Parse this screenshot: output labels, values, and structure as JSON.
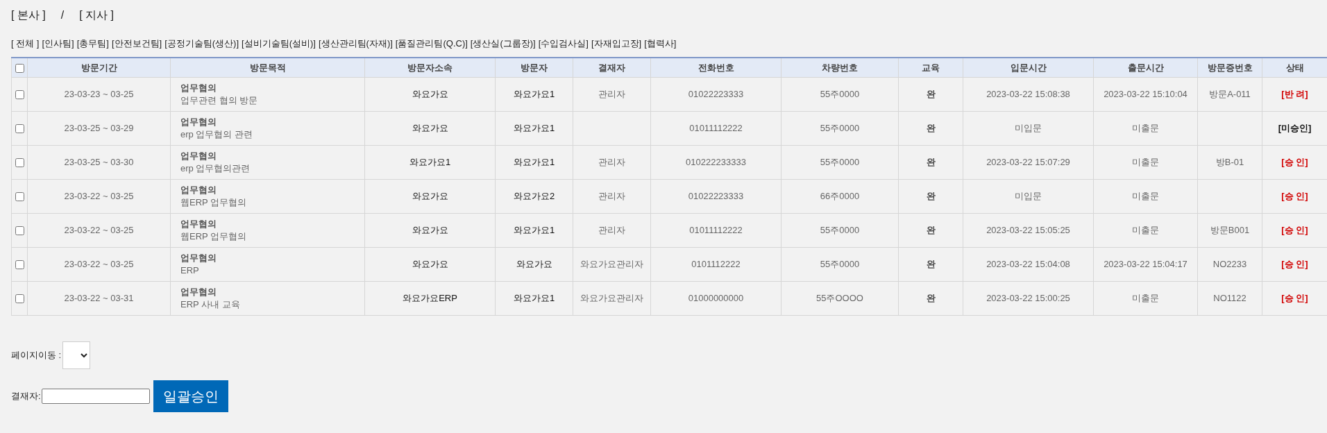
{
  "branch_links": [
    "[ 본사 ]",
    "[ 지사 ]"
  ],
  "branch_separator": "/",
  "department_links": [
    "[ 전체 ]",
    "[인사팀]",
    "[총무팀]",
    "[안전보건팀]",
    "[공정기술팀(생산)]",
    "[설비기술팀(설비)]",
    "[생산관리팀(자재)]",
    "[품질관리팀(Q.C)]",
    "[생산실(그룹장)]",
    "[수입검사실]",
    "[자재입고장]",
    "[협력사]"
  ],
  "table": {
    "select_all_checked": false,
    "columns": [
      "방문기간",
      "방문목적",
      "방문자소속",
      "방문자",
      "결재자",
      "전화번호",
      "차량번호",
      "교육",
      "입문시간",
      "출문시간",
      "방문증번호",
      "상태"
    ],
    "rows": [
      {
        "checked": false,
        "period": "23-03-23 ~ 03-25",
        "purpose_title": "업무협의",
        "purpose_detail": "업무관련 협의 방문",
        "company": "와요가요",
        "visitor": "와요가요1",
        "approver": "관리자",
        "phone": "01022223333",
        "vehicle": "55주0000",
        "education": "완",
        "entry_time": "2023-03-22 15:08:38",
        "exit_time": "2023-03-22 15:10:04",
        "pass_number": "방문A-011",
        "status": {
          "text": "[반 려]",
          "color": "#d10000"
        }
      },
      {
        "checked": false,
        "period": "23-03-25 ~ 03-29",
        "purpose_title": "업무협의",
        "purpose_detail": "erp 업무협의 관련",
        "company": "와요가요",
        "visitor": "와요가요1",
        "approver": "",
        "phone": "01011112222",
        "vehicle": "55주0000",
        "education": "완",
        "entry_time": "미입문",
        "exit_time": "미출문",
        "pass_number": "",
        "status": {
          "text": "[미승인]",
          "color": "#111111"
        }
      },
      {
        "checked": false,
        "period": "23-03-25 ~ 03-30",
        "purpose_title": "업무협의",
        "purpose_detail": "erp 업무협의관련",
        "company": "와요가요1",
        "visitor": "와요가요1",
        "approver": "관리자",
        "phone": "010222233333",
        "vehicle": "55주0000",
        "education": "완",
        "entry_time": "2023-03-22 15:07:29",
        "exit_time": "미출문",
        "pass_number": "방B-01",
        "status": {
          "text": "[승 인]",
          "color": "#d10000"
        }
      },
      {
        "checked": false,
        "period": "23-03-22 ~ 03-25",
        "purpose_title": "업무협의",
        "purpose_detail": "웹ERP 업무협의",
        "company": "와요가요",
        "visitor": "와요가요2",
        "approver": "관리자",
        "phone": "01022223333",
        "vehicle": "66주0000",
        "education": "완",
        "entry_time": "미입문",
        "exit_time": "미출문",
        "pass_number": "",
        "status": {
          "text": "[승 인]",
          "color": "#d10000"
        }
      },
      {
        "checked": false,
        "period": "23-03-22 ~ 03-25",
        "purpose_title": "업무협의",
        "purpose_detail": "웹ERP 업무협의",
        "company": "와요가요",
        "visitor": "와요가요1",
        "approver": "관리자",
        "phone": "01011112222",
        "vehicle": "55주0000",
        "education": "완",
        "entry_time": "2023-03-22 15:05:25",
        "exit_time": "미출문",
        "pass_number": "방문B001",
        "status": {
          "text": "[승 인]",
          "color": "#d10000"
        }
      },
      {
        "checked": false,
        "period": "23-03-22 ~ 03-25",
        "purpose_title": "업무협의",
        "purpose_detail": "ERP",
        "company": "와요가요",
        "visitor": "와요가요",
        "approver": "와요가요관리자",
        "phone": "0101112222",
        "vehicle": "55주0000",
        "education": "완",
        "entry_time": "2023-03-22 15:04:08",
        "exit_time": "2023-03-22 15:04:17",
        "pass_number": "NO2233",
        "status": {
          "text": "[승 인]",
          "color": "#d10000"
        }
      },
      {
        "checked": false,
        "period": "23-03-22 ~ 03-31",
        "purpose_title": "업무협의",
        "purpose_detail": "ERP 사내 교육",
        "company": "와요가요ERP",
        "visitor": "와요가요1",
        "approver": "와요가요관리자",
        "phone": "01000000000",
        "vehicle": "55주OOOO",
        "education": "완",
        "entry_time": "2023-03-22 15:00:25",
        "exit_time": "미출문",
        "pass_number": "NO1122",
        "status": {
          "text": "[승 인]",
          "color": "#d10000"
        }
      }
    ]
  },
  "page_move": {
    "label": "페이지이동 :"
  },
  "approver_field": {
    "label": "결재자:"
  },
  "bulk_approve_button": "일괄승인"
}
